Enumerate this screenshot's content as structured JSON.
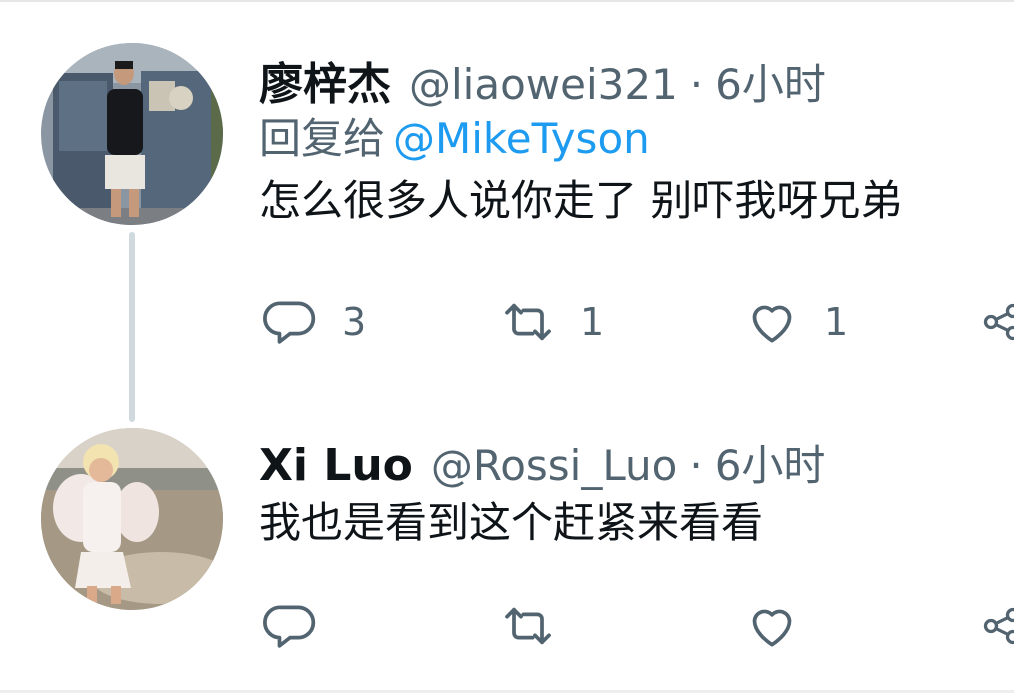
{
  "tweets": [
    {
      "author_name": "廖梓杰",
      "handle": "@liaowei321",
      "separator": "·",
      "time": "6小时",
      "reply_prefix": "回复给",
      "reply_mention": "@MikeTyson",
      "text": "怎么很多人说你走了 别吓我呀兄弟",
      "counts": {
        "reply": "3",
        "retweet": "1",
        "like": "1"
      }
    },
    {
      "author_name": "Xi Luo",
      "handle": "@Rossi_Luo",
      "separator": "·",
      "time": "6小时",
      "text": "我也是看到这个赶紧来看看",
      "counts": {
        "reply": "",
        "retweet": "",
        "like": ""
      }
    }
  ],
  "colors": {
    "name": "#0f1419",
    "secondary": "#536471",
    "mention": "#1d9bf0",
    "thread_line": "#cfd9de"
  },
  "icons": [
    "reply-icon",
    "retweet-icon",
    "like-icon",
    "share-icon"
  ]
}
